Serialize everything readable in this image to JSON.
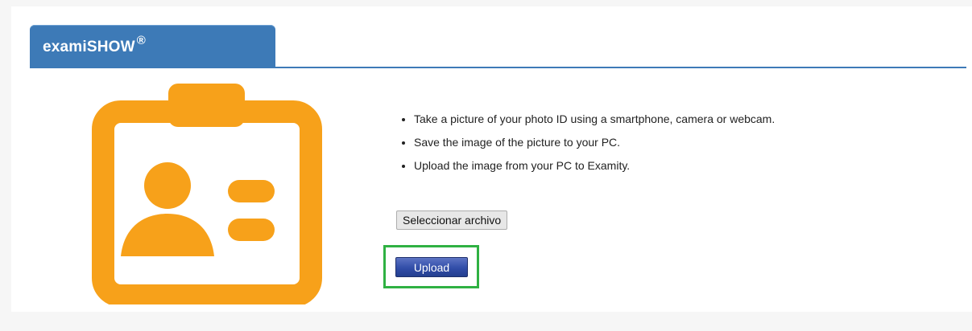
{
  "header": {
    "title": "examiSHOW",
    "trademark": "®"
  },
  "instructions": [
    "Take a picture of your photo ID using a smartphone, camera or webcam.",
    "Save the image of the picture to your PC.",
    "Upload the image from your PC to Examity."
  ],
  "file_input": {
    "button_label": "Seleccionar archivo"
  },
  "upload": {
    "label": "Upload"
  },
  "colors": {
    "tab_blue": "#3d7ab7",
    "id_orange": "#f7a11a",
    "upload_button": "#314da8",
    "highlight_green": "#2fb142"
  },
  "icons": {
    "id_card": "id-card-icon"
  }
}
